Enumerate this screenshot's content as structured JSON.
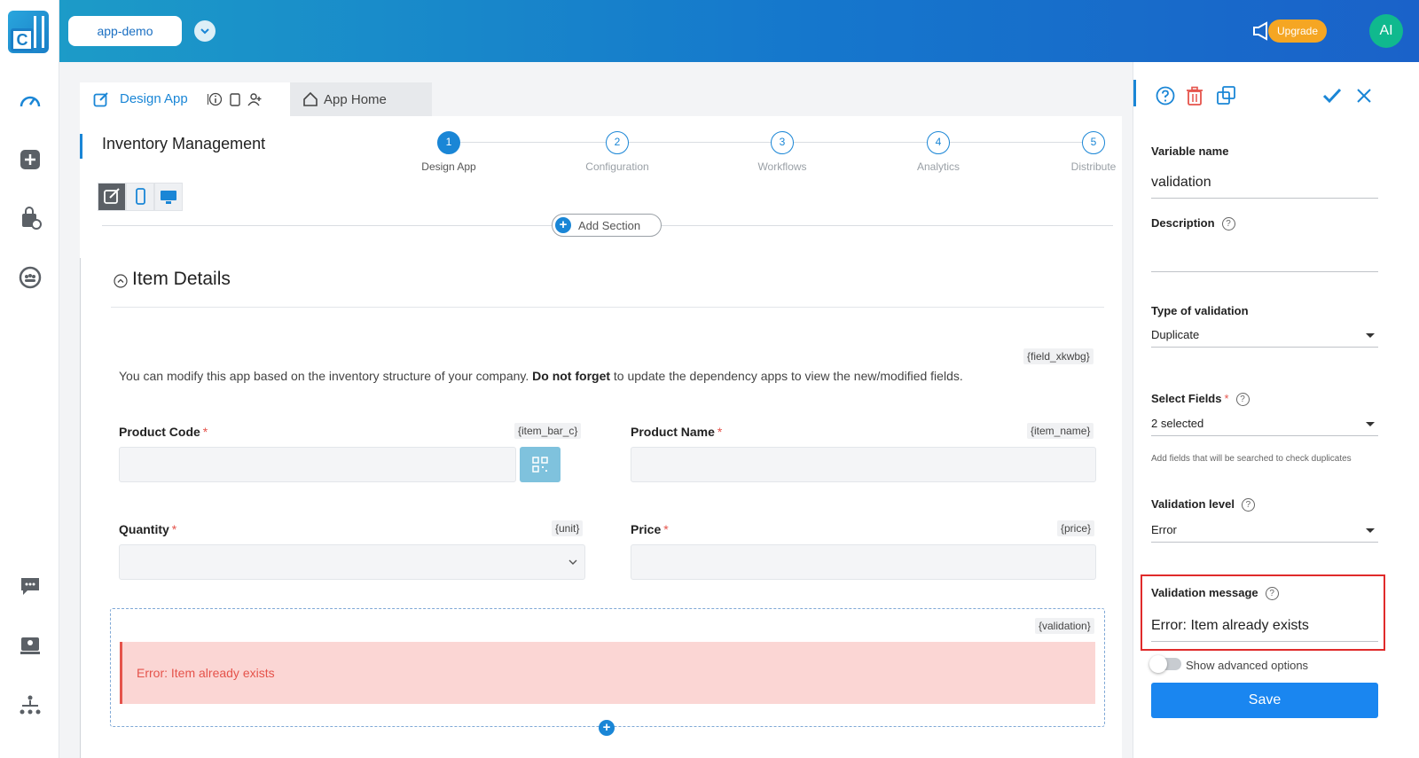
{
  "topbar": {
    "app_name": "app-demo",
    "upgrade_label": "Upgrade",
    "avatar_initials": "AI"
  },
  "tabs": {
    "design_app": "Design App",
    "app_home": "App Home"
  },
  "page": {
    "title": "Inventory Management"
  },
  "stepper": {
    "steps": [
      {
        "num": "1",
        "label": "Design App"
      },
      {
        "num": "2",
        "label": "Configuration"
      },
      {
        "num": "3",
        "label": "Workflows"
      },
      {
        "num": "4",
        "label": "Analytics"
      },
      {
        "num": "5",
        "label": "Distribute"
      }
    ],
    "active_index": 0
  },
  "add_section_label": "Add Section",
  "section": {
    "title": "Item Details",
    "field_tag": "{field_xkwbg}",
    "info_pre": "You can modify this app based on the inventory structure of your company. ",
    "info_bold": "Do not forget",
    "info_post": " to update the dependency apps to view the new/modified fields.",
    "fields": {
      "product_code": {
        "label": "Product Code",
        "tag": "{item_bar_c}",
        "required": "*"
      },
      "product_name": {
        "label": "Product Name",
        "tag": "{item_name}",
        "required": "*"
      },
      "quantity": {
        "label": "Quantity",
        "tag": "{unit}",
        "required": "*"
      },
      "price": {
        "label": "Price",
        "tag": "{price}",
        "required": "*"
      }
    },
    "validation": {
      "tag": "{validation}",
      "message": "Error: Item already exists"
    }
  },
  "props": {
    "variable_name_label": "Variable name",
    "variable_name_value": "validation",
    "description_label": "Description",
    "type_label": "Type of validation",
    "type_value": "Duplicate",
    "select_fields_label": "Select Fields",
    "select_fields_required": "*",
    "select_fields_value": "2 selected",
    "select_fields_hint": "Add fields that will be searched to check duplicates",
    "level_label": "Validation level",
    "level_value": "Error",
    "message_label": "Validation message",
    "message_value": "Error: Item already exists",
    "advanced_label": "Show advanced options",
    "advanced_enabled": false,
    "save_label": "Save",
    "help_glyph": "?"
  },
  "colors": {
    "accent": "#1a86d6",
    "error": "#e5534b",
    "upgrade": "#f5a623",
    "avatar": "#10b98e"
  }
}
